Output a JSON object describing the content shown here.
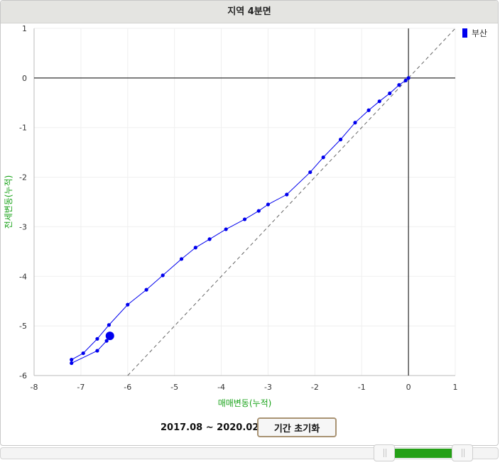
{
  "panel": {
    "title": "지역 4분면"
  },
  "controls": {
    "period_text": "2017.08 ~ 2020.02",
    "reset_label": "기간 초기화",
    "slider": {
      "start_fraction": 0.79,
      "end_fraction": 0.905
    }
  },
  "chart_data": {
    "type": "line",
    "xlabel": "매매변동(누적)",
    "ylabel": "전세변동(누적)",
    "xlim": [
      -8,
      1
    ],
    "ylim": [
      -6,
      1
    ],
    "xticks": [
      -8,
      -7,
      -6,
      -5,
      -4,
      -3,
      -2,
      -1,
      0,
      1
    ],
    "yticks": [
      1,
      0,
      -1,
      -2,
      -3,
      -4,
      -5,
      -6
    ],
    "grid": true,
    "legend": "top-right",
    "reference_line": {
      "style": "dashed",
      "x": [
        -6,
        1
      ],
      "y": [
        -6,
        1
      ]
    },
    "series": [
      {
        "name": "부산",
        "color": "#0000ee",
        "x": [
          0,
          -0.06,
          -0.2,
          -0.4,
          -0.62,
          -0.85,
          -1.14,
          -1.45,
          -1.82,
          -2.1,
          -2.6,
          -3.0,
          -3.2,
          -3.5,
          -3.9,
          -4.25,
          -4.55,
          -4.85,
          -5.25,
          -5.6,
          -6.0,
          -6.4,
          -6.65,
          -6.95,
          -7.2,
          -7.2,
          -6.65,
          -6.45
        ],
        "y": [
          0,
          -0.05,
          -0.14,
          -0.31,
          -0.47,
          -0.65,
          -0.9,
          -1.24,
          -1.6,
          -1.9,
          -2.35,
          -2.55,
          -2.68,
          -2.85,
          -3.05,
          -3.25,
          -3.42,
          -3.65,
          -3.98,
          -4.27,
          -4.57,
          -4.98,
          -5.26,
          -5.55,
          -5.68,
          -5.75,
          -5.5,
          -5.3
        ]
      }
    ],
    "current_point": {
      "x": -6.38,
      "y": -5.2
    },
    "axis_line_color": "#000000",
    "label_color": "#1aa31a"
  }
}
